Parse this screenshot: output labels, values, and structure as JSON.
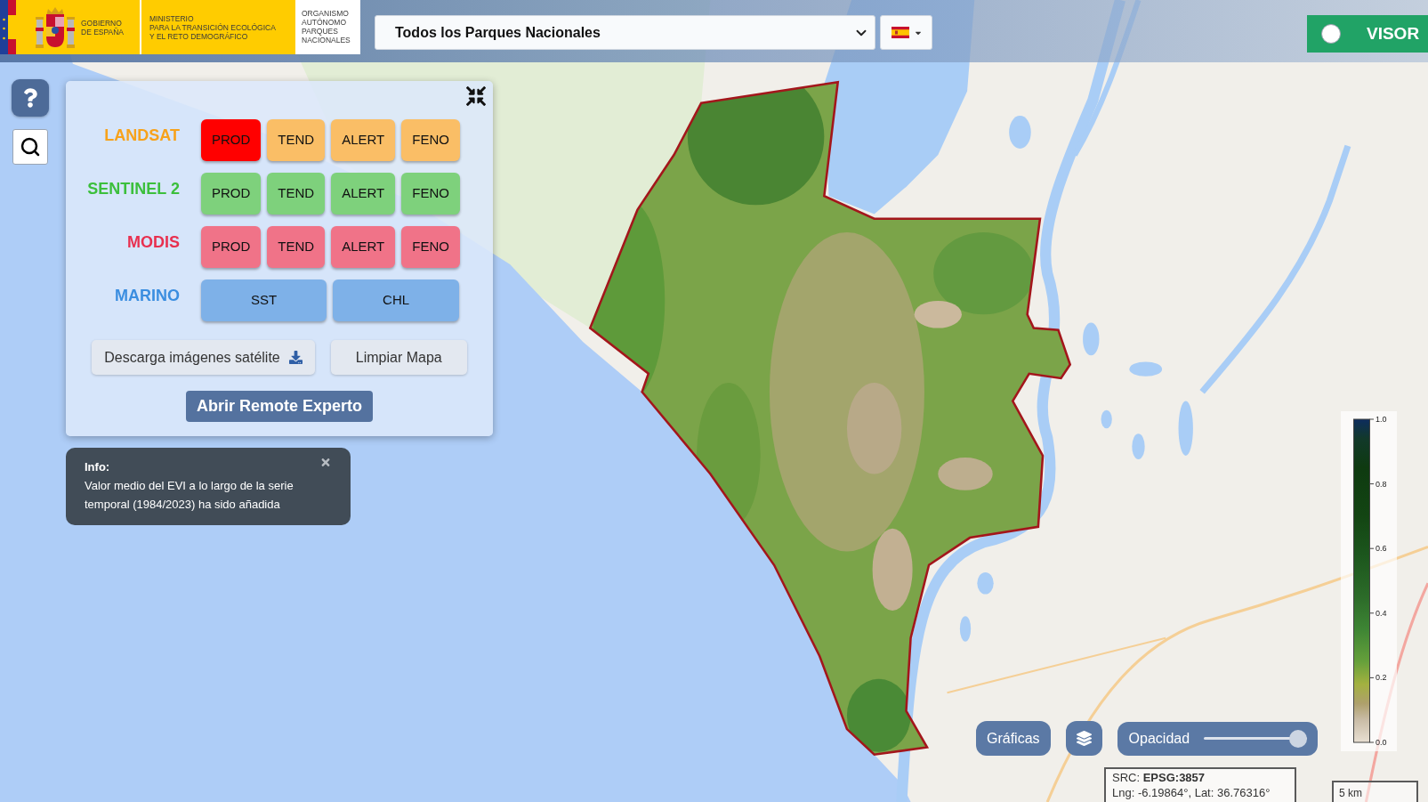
{
  "header": {
    "logo": {
      "government_lines": [
        "GOBIERNO",
        "DE ESPAÑA"
      ],
      "ministry_lines": [
        "MINISTERIO",
        "PARA LA TRANSICIÓN ECOLÓGICA",
        "Y EL RETO DEMOGRÁFICO"
      ],
      "agency_lines": [
        "ORGANISMO",
        "AUTÓNOMO",
        "PARQUES",
        "NACIONALES"
      ]
    },
    "park_select": {
      "value": "Todos los Parques Nacionales"
    },
    "visor_switch": {
      "label": "VISOR",
      "on": false
    }
  },
  "panel": {
    "sensors": [
      {
        "name": "LANDSAT",
        "color": "#f7a21b",
        "buttons": [
          {
            "label": "PROD",
            "selected": true
          },
          {
            "label": "TEND",
            "selected": false
          },
          {
            "label": "ALERT",
            "selected": false
          },
          {
            "label": "FENO",
            "selected": false
          }
        ]
      },
      {
        "name": "SENTINEL 2",
        "color": "#3cbf3c",
        "buttons": [
          {
            "label": "PROD",
            "selected": false
          },
          {
            "label": "TEND",
            "selected": false
          },
          {
            "label": "ALERT",
            "selected": false
          },
          {
            "label": "FENO",
            "selected": false
          }
        ]
      },
      {
        "name": "MODIS",
        "color": "#e8304f",
        "buttons": [
          {
            "label": "PROD",
            "selected": false
          },
          {
            "label": "TEND",
            "selected": false
          },
          {
            "label": "ALERT",
            "selected": false
          },
          {
            "label": "FENO",
            "selected": false
          }
        ]
      },
      {
        "name": "MARINO",
        "color": "#3b8ee0",
        "buttons": [
          {
            "label": "SST",
            "selected": false
          },
          {
            "label": "CHL",
            "selected": false
          }
        ]
      }
    ],
    "actions": [
      {
        "label": "Descarga imágenes satélite",
        "kind": "download"
      },
      {
        "label": "Limpiar Mapa",
        "kind": "plain"
      }
    ],
    "primary_button": "Abrir Remote Experto"
  },
  "info_toast": {
    "title": "Info:",
    "text": "Valor medio del EVI a lo largo de la serie temporal (1984/2023) ha sido añadida"
  },
  "legend": {
    "ticks": [
      "1.0",
      "0.8",
      "0.6",
      "0.4",
      "0.2",
      "0.0"
    ]
  },
  "map_controls": {
    "charts_button": "Gráficas",
    "opacity": {
      "label": "Opacidad",
      "level": 1
    }
  },
  "coordinates": {
    "crs": "SRC: **EPSG:3857**",
    "position": "Lng: -6.19864°, Lat: 36.76316°"
  },
  "scale_bar": {
    "label": "5 km"
  }
}
